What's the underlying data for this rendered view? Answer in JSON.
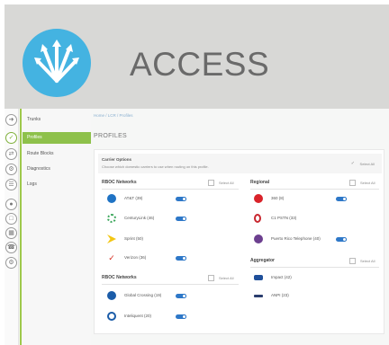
{
  "banner": {
    "title": "ACCESS",
    "logo_icon": "arrows-burst-icon",
    "logo_color": "#44b3e1"
  },
  "breadcrumb": "Home / LCR / Profiles",
  "page_title": "PROFILES",
  "rail": {
    "icons": [
      "arrow-right-icon",
      "check-icon",
      "route-icon",
      "diagnostics-icon",
      "logs-icon",
      "user-icon",
      "document-icon",
      "grid-icon",
      "phone-icon",
      "settings-icon"
    ]
  },
  "sidebar": {
    "items": [
      {
        "label": "Trunks"
      },
      {
        "label": "Profiles"
      },
      {
        "label": "Route Blocks"
      },
      {
        "label": "Diagnostics"
      },
      {
        "label": "Logs"
      }
    ]
  },
  "carrier_options": {
    "title": "Carrier Options",
    "description": "Choose which domestic carriers to use when routing on this profile.",
    "select_all": "Select All"
  },
  "rboc": {
    "title": "RBOC Networks",
    "select_all": "Select All",
    "carriers": [
      {
        "name": "AT&T (39)",
        "logo": "att-globe-icon",
        "toggle": true
      },
      {
        "name": "CenturyLink (46)",
        "logo": "centurylink-icon",
        "toggle": true
      },
      {
        "name": "Sprint (50)",
        "logo": "sprint-icon",
        "toggle": false
      },
      {
        "name": "Verizon (36)",
        "logo": "verizon-check-icon",
        "toggle": true
      }
    ]
  },
  "regional": {
    "title": "Regional",
    "select_all": "Select All",
    "carriers": [
      {
        "name": "360 (8)",
        "logo": "360-icon",
        "toggle": true
      },
      {
        "name": "C1 PSTN (33)",
        "logo": "o-ring-icon",
        "toggle": false
      },
      {
        "name": "Puerto Rico Telephone (40)",
        "logo": "pr-icon",
        "toggle": true
      }
    ]
  },
  "rboc2": {
    "title": "RBOC Networks",
    "select_all": "Select All",
    "carriers": [
      {
        "name": "Global Crossing (19)",
        "logo": "global-crossing-icon",
        "toggle": true
      },
      {
        "name": "Inteliquent (20)",
        "logo": "inteliquent-icon",
        "toggle": true
      }
    ]
  },
  "aggregator": {
    "title": "Aggregator",
    "select_all": "Select All",
    "carriers": [
      {
        "name": "Impact (42)",
        "logo": "impact-icon"
      },
      {
        "name": "ANPI (23)",
        "logo": "anpi-icon"
      }
    ]
  },
  "colors": {
    "accent_green": "#8ec14b",
    "toggle_blue": "#2e78c8",
    "banner_gray": "#d8d8d6"
  }
}
